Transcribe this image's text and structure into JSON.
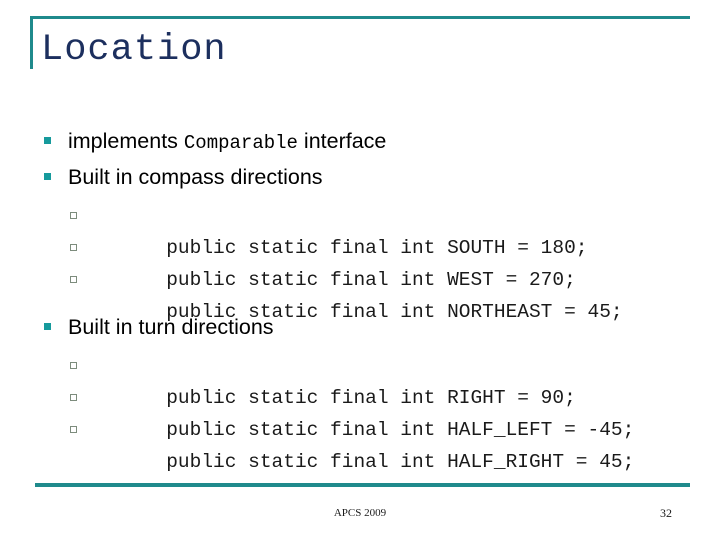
{
  "slide": {
    "title": "Location",
    "accent_color": "#1f8a8c",
    "title_color": "#1c2f5e",
    "bullet_l1_color": "#169a9c",
    "bullet_l2_border_color": "#7d8c7d",
    "background_color": "#ffffff"
  },
  "content": {
    "bullets": [
      {
        "level": 1,
        "text_before_code": "implements ",
        "code": "Comparable",
        "text_after_code": " interface"
      },
      {
        "level": 1,
        "text_before_code": "Built in compass directions",
        "code": "",
        "text_after_code": ""
      }
    ],
    "compass_heading": "Built in compass directions",
    "compass_constants": [
      "public static final int SOUTH = 180;",
      "public static final int WEST = 270;",
      "public static final int NORTHEAST = 45;"
    ],
    "turn_heading": "Built in turn directions",
    "turn_constants": [
      "public static final int RIGHT = 90;",
      "public static final int HALF_LEFT = -45;",
      "public static final int HALF_RIGHT = 45;"
    ],
    "first_bullet": {
      "prefix": "implements ",
      "code": "Comparable",
      "suffix": " interface"
    }
  },
  "footer": {
    "center_text": "APCS 2009",
    "page_number": "32"
  }
}
